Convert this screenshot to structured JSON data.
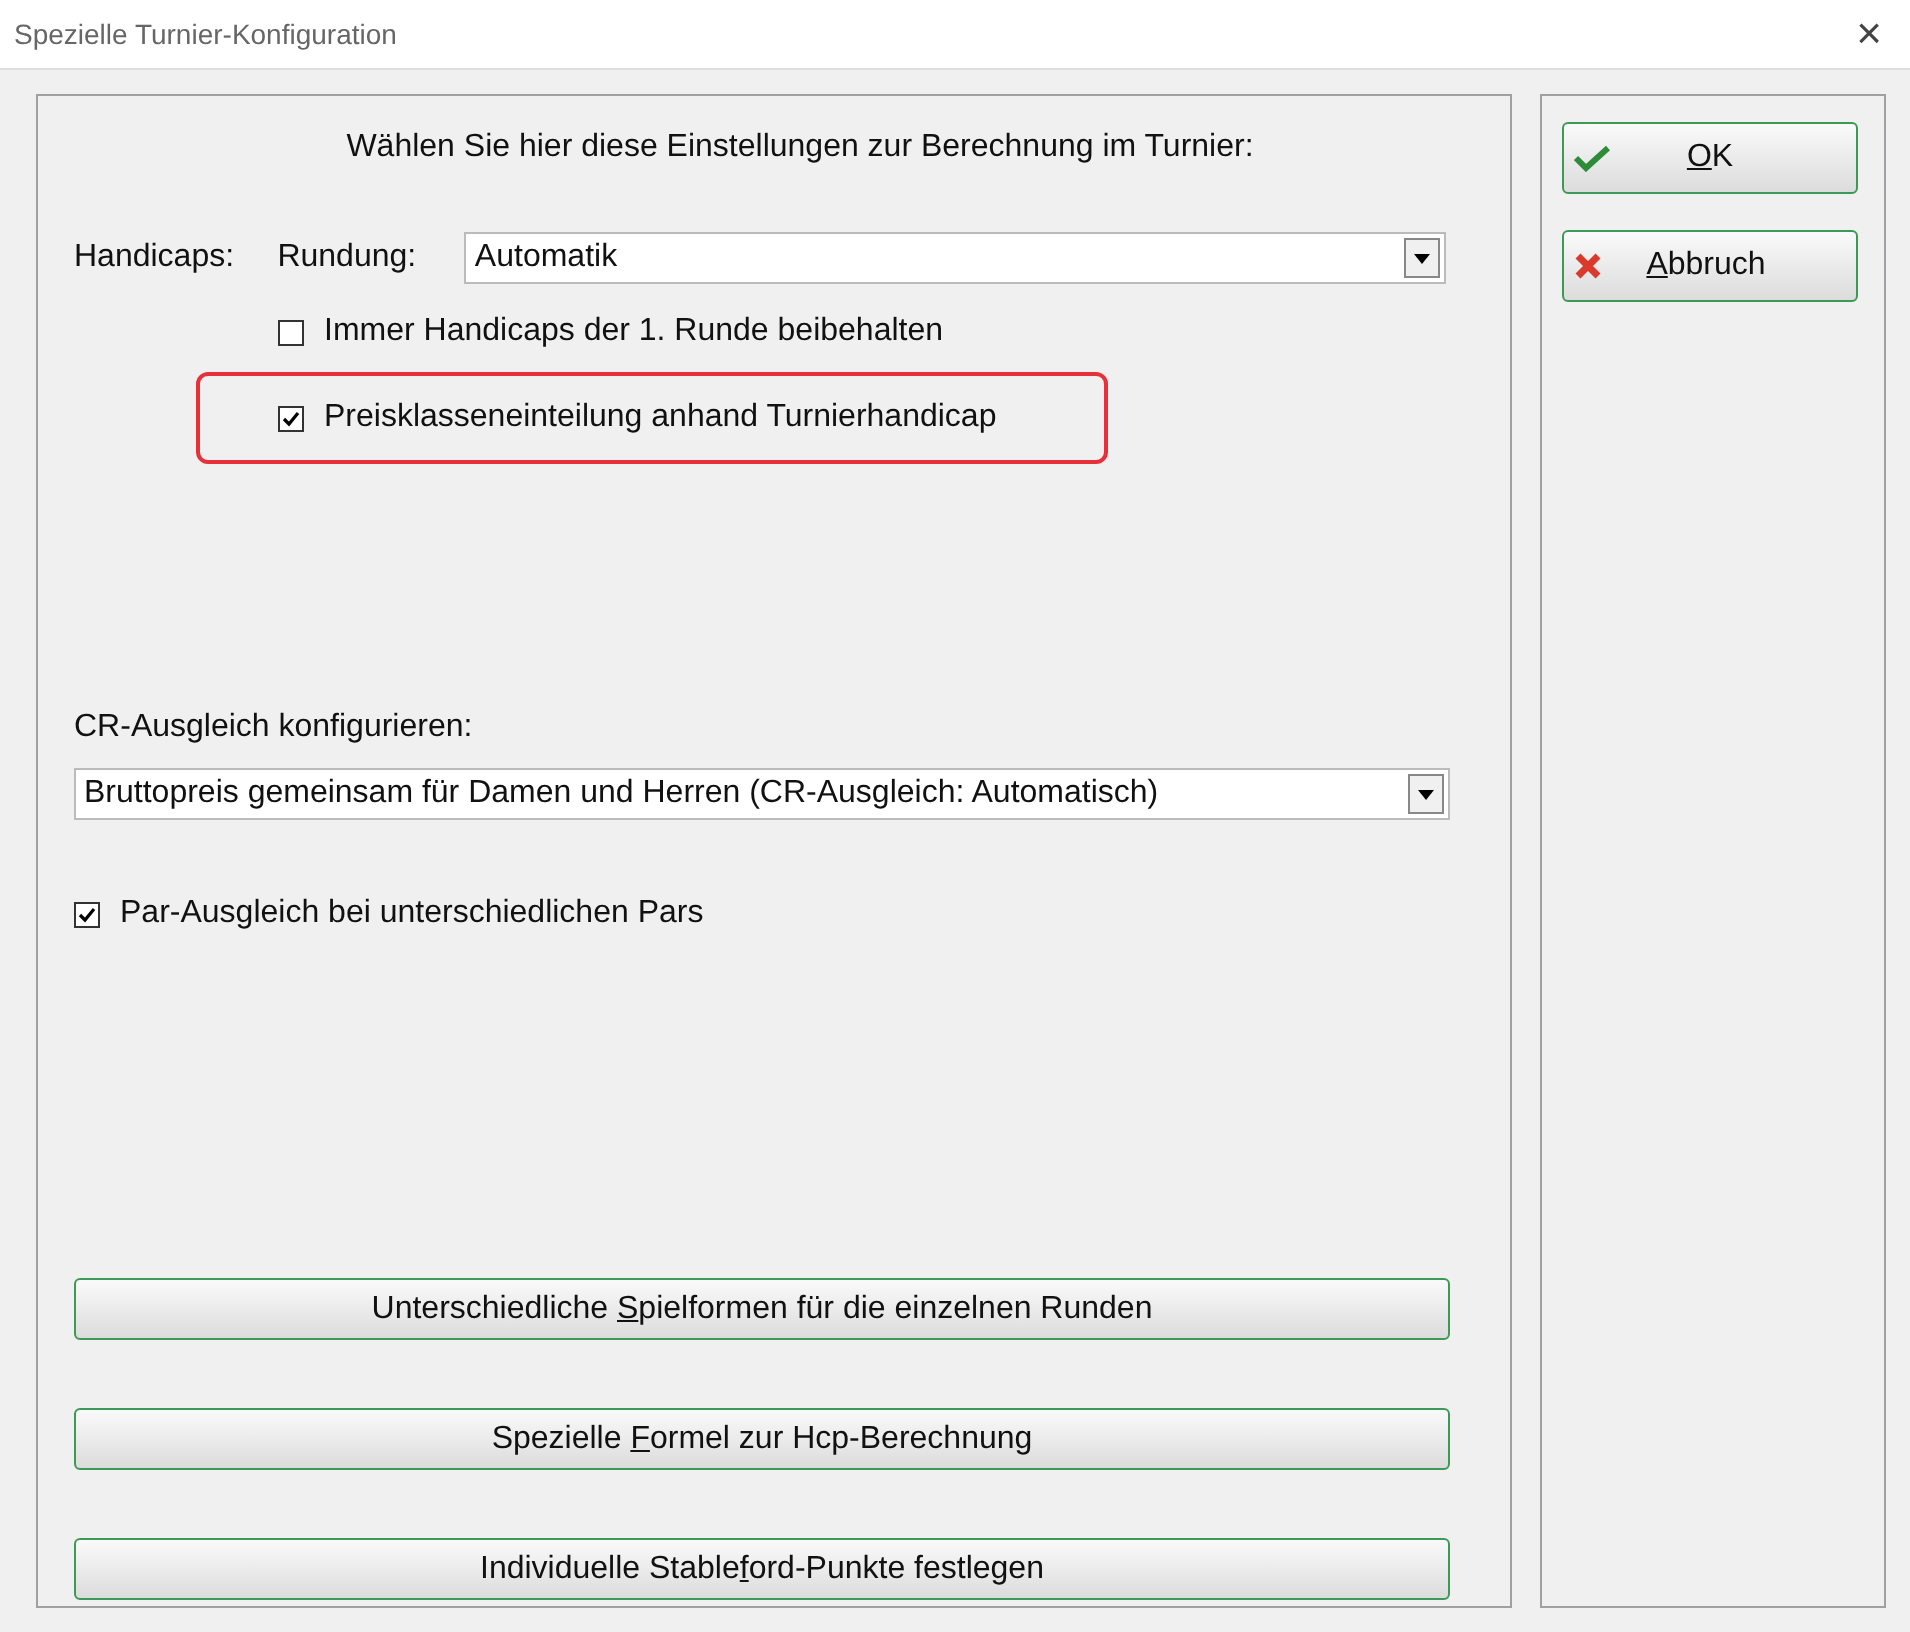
{
  "window": {
    "title": "Spezielle Turnier-Konfiguration",
    "close": "×"
  },
  "heading": "Wählen Sie hier diese Einstellungen zur Berechnung im Turnier:",
  "handicaps": {
    "label": "Handicaps:",
    "rounding_label": "Rundung:",
    "rounding_value": "Automatik",
    "options": [
      {
        "label": "Immer Handicaps der 1. Runde beibehalten",
        "checked": false,
        "highlighted": false
      },
      {
        "label": "Preisklasseneinteilung anhand Turnierhandicap",
        "checked": true,
        "highlighted": true
      }
    ]
  },
  "cr": {
    "label": "CR-Ausgleich konfigurieren:",
    "value": "Bruttopreis gemeinsam für Damen und Herren (CR-Ausgleich: Automatisch)"
  },
  "par": {
    "label": "Par-Ausgleich bei unterschiedlichen Pars",
    "checked": true
  },
  "actions": [
    {
      "before": "Unterschiedliche ",
      "key": "S",
      "after": "pielformen für die einzelnen Runden"
    },
    {
      "before": "Spezielle ",
      "key": "F",
      "after": "ormel zur Hcp-Berechnung"
    },
    {
      "before": "Individuelle Stable",
      "key": "f",
      "after": "ord-Punkte festlegen"
    }
  ],
  "buttons": [
    {
      "kind": "ok",
      "key": "O",
      "after": "K"
    },
    {
      "kind": "cancel",
      "key": "A",
      "after": "bbruch"
    }
  ]
}
